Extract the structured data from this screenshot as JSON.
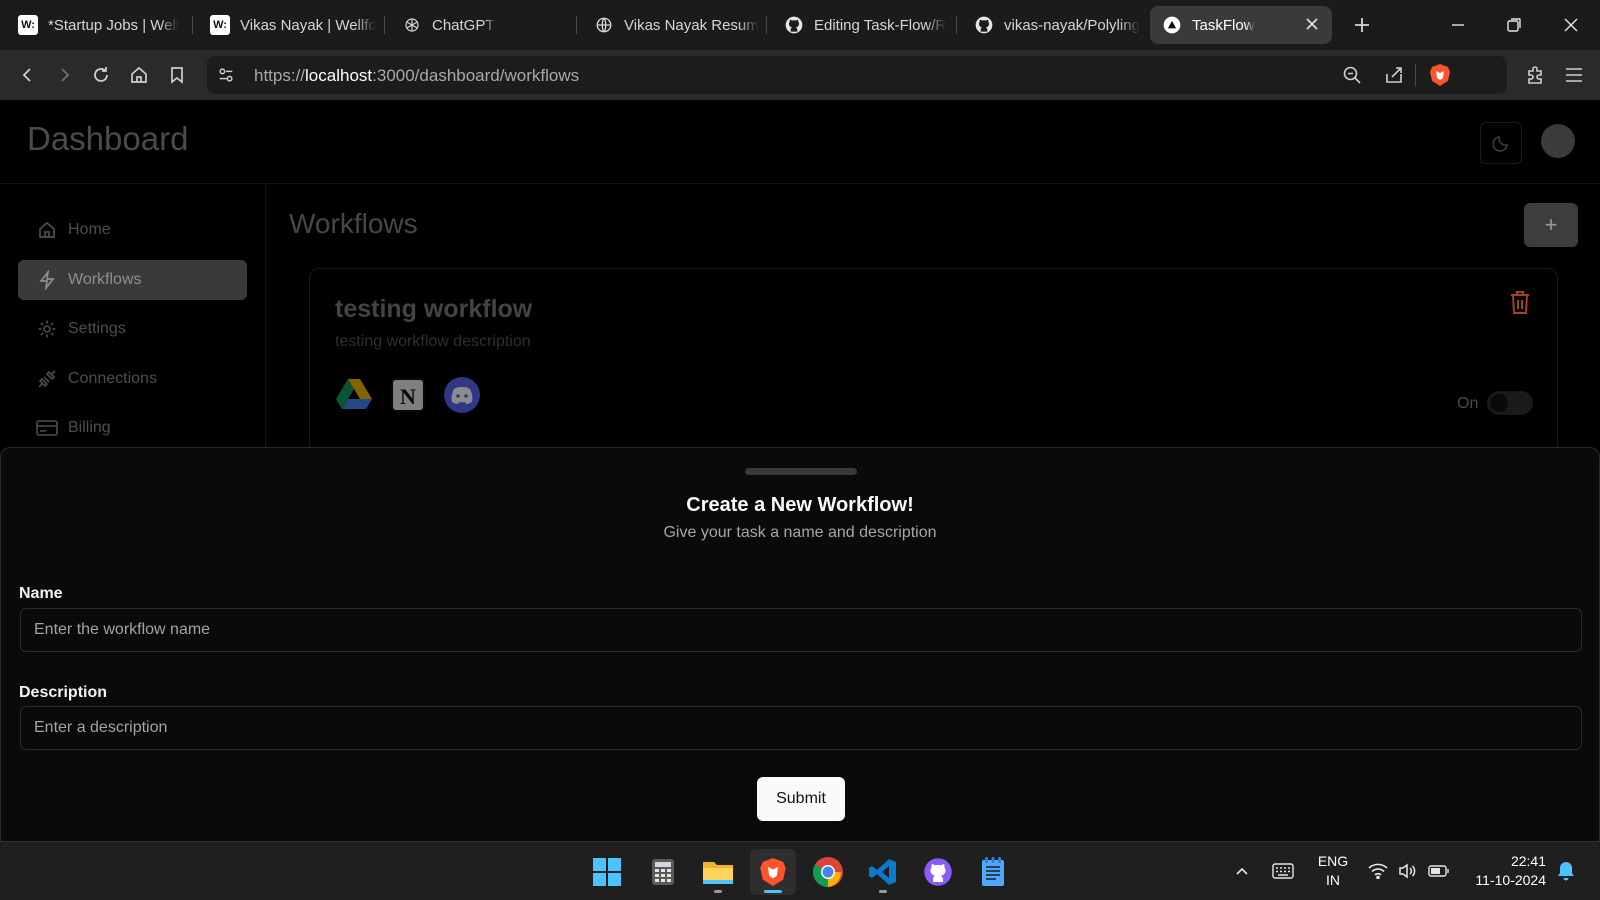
{
  "browser": {
    "tabs": [
      {
        "title": "*Startup Jobs | Well",
        "icon": "wellfound-icon"
      },
      {
        "title": "Vikas Nayak | Wellfo",
        "icon": "wellfound-icon"
      },
      {
        "title": "ChatGPT",
        "icon": "openai-icon"
      },
      {
        "title": "Vikas Nayak Resum",
        "icon": "globe-icon"
      },
      {
        "title": "Editing Task-Flow/R",
        "icon": "github-icon"
      },
      {
        "title": "vikas-nayak/Polyling",
        "icon": "github-icon"
      },
      {
        "title": "TaskFlow",
        "icon": "vercel-triangle-icon",
        "active": true
      }
    ],
    "url_prefix": "https://",
    "url_host": "localhost",
    "url_rest": ":3000/dashboard/workflows"
  },
  "header": {
    "title": "Dashboard"
  },
  "sidebar": {
    "items": [
      {
        "label": "Home",
        "icon": "home-icon"
      },
      {
        "label": "Workflows",
        "icon": "lightning-icon",
        "active": true
      },
      {
        "label": "Settings",
        "icon": "gear-icon"
      },
      {
        "label": "Connections",
        "icon": "plug-icon"
      },
      {
        "label": "Billing",
        "icon": "credit-card-icon"
      }
    ]
  },
  "main": {
    "title": "Workflows",
    "add_button": "+",
    "workflow": {
      "name": "testing workflow",
      "description": "testing workflow description",
      "integrations": [
        "google-drive-icon",
        "notion-icon",
        "discord-icon"
      ],
      "toggle_label": "On"
    }
  },
  "drawer": {
    "title": "Create a New Workflow!",
    "subtitle": "Give your task a name and description",
    "name_label": "Name",
    "name_placeholder": "Enter the workflow name",
    "description_label": "Description",
    "description_placeholder": "Enter a description",
    "submit_label": "Submit"
  },
  "taskbar": {
    "apps": [
      "windows-start-icon",
      "calculator-icon",
      "file-explorer-icon",
      "brave-icon",
      "chrome-icon",
      "vscode-icon",
      "github-desktop-icon",
      "notepad-icon"
    ],
    "language_line1": "ENG",
    "language_line2": "IN",
    "time": "22:41",
    "date": "11-10-2024"
  },
  "colors": {
    "accent_blue": "#4cc2ff",
    "brave_orange": "#fb542b",
    "delete_orange": "#a0461e"
  }
}
